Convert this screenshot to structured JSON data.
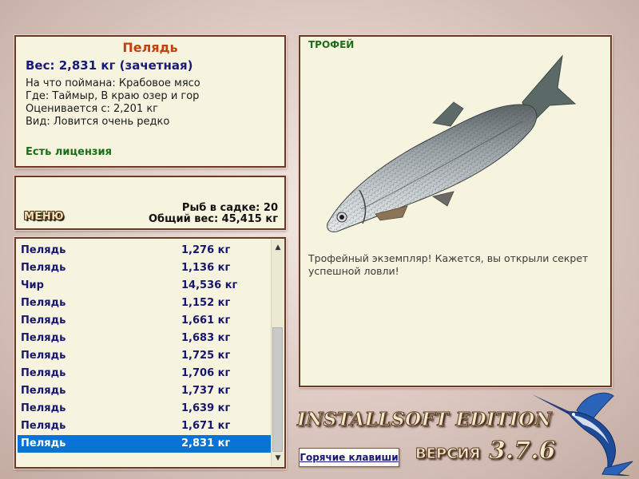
{
  "info": {
    "fish_name": "Пелядь",
    "weight_line": "Вес: 2,831 кг (зачетная)",
    "bait": "На что поймана: Крабовое мясо",
    "location": "Где: Таймыр, В краю озер и гор",
    "valued_from": "Оценивается с: 2,201 кг",
    "rarity": "Вид: Ловится очень редко",
    "license": "Есть лицензия"
  },
  "stats": {
    "menu_label": "МЕНЮ",
    "fish_in_keepnet": "Рыб в садке: 20",
    "total_weight": "Общий вес: 45,415 кг"
  },
  "catch_list": [
    {
      "name": "Пелядь",
      "weight": "1,276 кг"
    },
    {
      "name": "Пелядь",
      "weight": "1,136 кг"
    },
    {
      "name": "Чир",
      "weight": "14,536 кг"
    },
    {
      "name": "Пелядь",
      "weight": "1,152 кг"
    },
    {
      "name": "Пелядь",
      "weight": "1,661 кг"
    },
    {
      "name": "Пелядь",
      "weight": "1,683 кг"
    },
    {
      "name": "Пелядь",
      "weight": "1,725 кг"
    },
    {
      "name": "Пелядь",
      "weight": "1,706 кг"
    },
    {
      "name": "Пелядь",
      "weight": "1,737 кг"
    },
    {
      "name": "Пелядь",
      "weight": "1,639 кг"
    },
    {
      "name": "Пелядь",
      "weight": "1,671 кг"
    },
    {
      "name": "Пелядь",
      "weight": "2,831 кг",
      "selected": true
    }
  ],
  "trophy": {
    "label": "ТРОФЕЙ",
    "description": "Трофейный экземпляр! Кажется, вы открыли секрет успешной ловли!"
  },
  "footer": {
    "hotkeys_label": "Горячие клавиши",
    "edition": "INSTALLSOFT EDITION",
    "version_label": "ВЕРСИЯ",
    "version_number": "3.7.6"
  },
  "icons": {
    "scroll_up": "triangle-up-icon",
    "scroll_down": "triangle-down-icon",
    "trophy_fish": "fish-illustration",
    "logo": "marlin-logo"
  },
  "colors": {
    "panel_bg": "#f6f4df",
    "panel_border": "#6b3826",
    "selection": "#0a74d6",
    "fish_name": "#c0420f",
    "license": "#1b6e17"
  }
}
